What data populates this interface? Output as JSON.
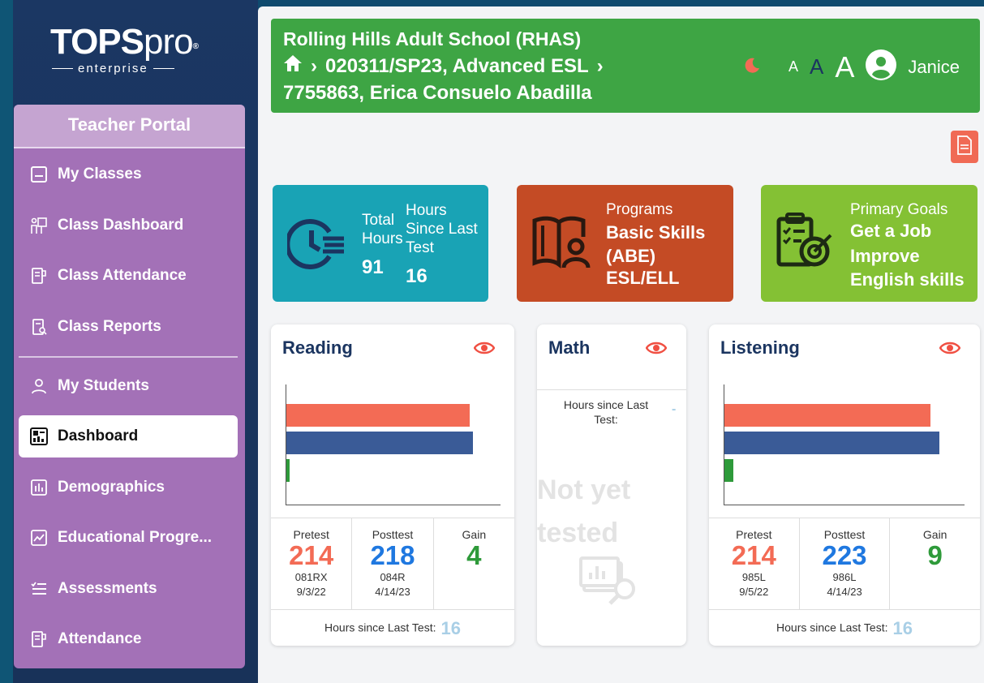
{
  "logo": {
    "brand_main": "TOPS",
    "brand_pro": "pro",
    "registered": "®",
    "sub": "enterprise"
  },
  "sidebar": {
    "title": "Teacher Portal",
    "items": [
      {
        "label": "My Classes",
        "icon": "class-icon"
      },
      {
        "label": "Class Dashboard",
        "icon": "presentation-icon"
      },
      {
        "label": "Class Attendance",
        "icon": "attendance-icon"
      },
      {
        "label": "Class Reports",
        "icon": "report-icon"
      },
      {
        "label": "My Students",
        "icon": "user-icon"
      },
      {
        "label": "Dashboard",
        "icon": "dashboard-icon",
        "active": true
      },
      {
        "label": "Demographics",
        "icon": "chart-icon"
      },
      {
        "label": "Educational Progre...",
        "icon": "progress-icon"
      },
      {
        "label": "Assessments",
        "icon": "checklist-icon"
      },
      {
        "label": "Attendance",
        "icon": "attendance-icon"
      }
    ]
  },
  "header": {
    "school": "Rolling Hills Adult School (RHAS)",
    "breadcrumb_class": "020311/SP23, Advanced ESL",
    "breadcrumb_student": "7755863, Erica Consuelo Abadilla",
    "separator": "›",
    "font_small": "A",
    "font_medium": "A",
    "font_large": "A",
    "user": "Janice"
  },
  "stats": {
    "total_hours_label": "Total Hours",
    "total_hours_value": "91",
    "hours_since_label": "Hours Since Last Test",
    "hours_since_value": "16",
    "programs_label": "Programs",
    "programs_values": [
      "Basic Skills (ABE)",
      "ESL/ELL"
    ],
    "goals_label": "Primary Goals",
    "goals_values": [
      "Get a Job",
      "Improve English skills"
    ]
  },
  "reading": {
    "title": "Reading",
    "pretest_label": "Pretest",
    "pretest_value": "214",
    "pretest_form": "081RX",
    "pretest_date": "9/3/22",
    "posttest_label": "Posttest",
    "posttest_value": "218",
    "posttest_form": "084R",
    "posttest_date": "4/14/23",
    "gain_label": "Gain",
    "gain_value": "4",
    "hours_label": "Hours since Last Test:",
    "hours_value": "16"
  },
  "math": {
    "title": "Math",
    "hours_label": "Hours since Last Test:",
    "hours_value": "-",
    "not_tested": "Not yet tested"
  },
  "listening": {
    "title": "Listening",
    "pretest_label": "Pretest",
    "pretest_value": "214",
    "pretest_form": "985L",
    "pretest_date": "9/5/22",
    "posttest_label": "Posttest",
    "posttest_value": "223",
    "posttest_form": "986L",
    "posttest_date": "4/14/23",
    "gain_label": "Gain",
    "gain_value": "9",
    "hours_label": "Hours since Last Test:",
    "hours_value": "16"
  },
  "colors": {
    "pretest": "#f36b55",
    "posttest": "#1f78e0",
    "gain": "#2e9a3a",
    "bar_posttest": "#3a5b97"
  }
}
